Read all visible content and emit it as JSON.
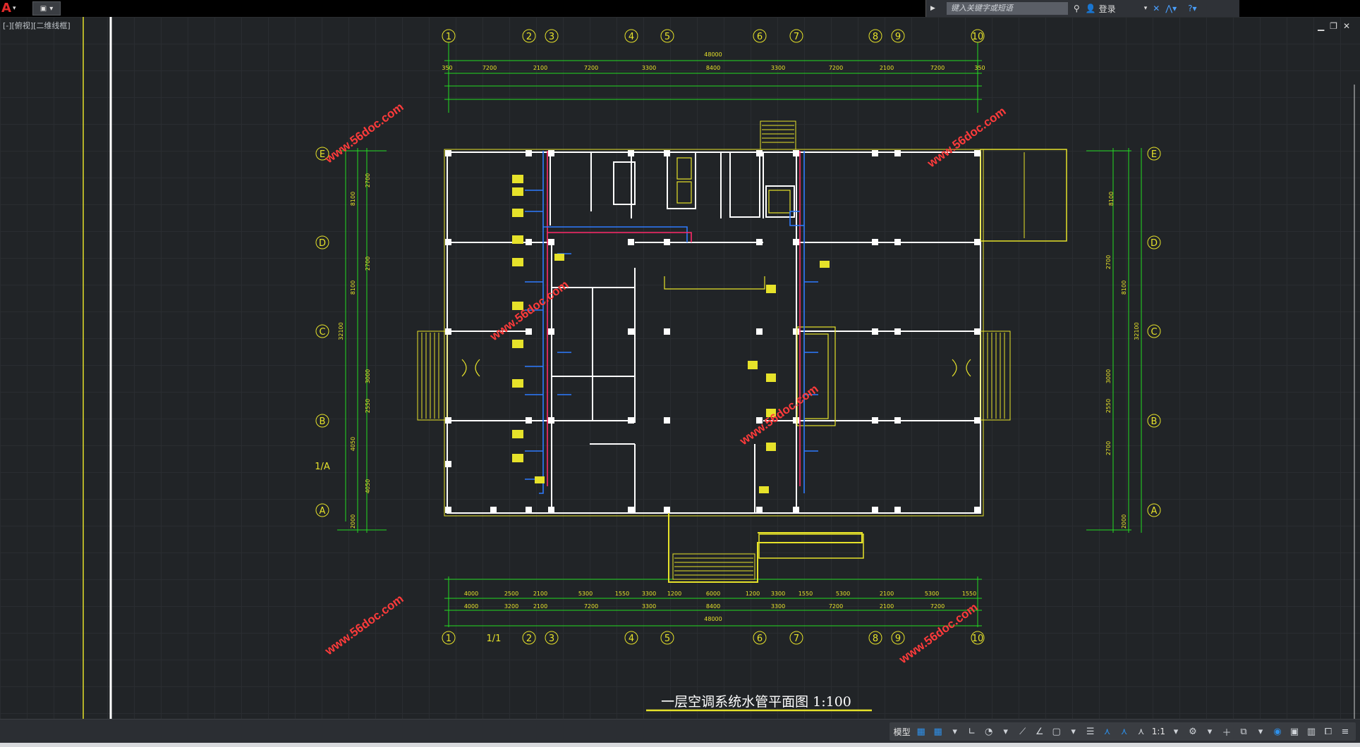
{
  "toolbar": {
    "search_placeholder": "键入关键字或短语",
    "login_label": "登录"
  },
  "viewport": {
    "label": "[-][俯视][二维线框]"
  },
  "drawing": {
    "title": "一层空调系统水管平面图 1:100",
    "watermark": "www.56doc.com",
    "axis_labels_top": [
      "1",
      "2",
      "3",
      "4",
      "5",
      "6",
      "7",
      "8",
      "9",
      "10"
    ],
    "axis_labels_bottom": [
      "1",
      "1/1",
      "2",
      "3",
      "4",
      "5",
      "6",
      "7",
      "8",
      "9",
      "10"
    ],
    "row_labels": [
      "E",
      "D",
      "C",
      "B",
      "1/A",
      "A"
    ],
    "dims_top_row1": [
      "350",
      "7200",
      "2100",
      "7200",
      "3300",
      "8400",
      "3300",
      "7200",
      "2100",
      "7200",
      "350"
    ],
    "dims_top_total": "48000",
    "dims_bottom_row1": [
      "4000",
      "2500",
      "2100",
      "5300",
      "1550",
      "3300",
      "1200",
      "6000",
      "1200",
      "3300",
      "1550",
      "5300",
      "2100",
      "5300",
      "1550"
    ],
    "dims_bottom_row2": [
      "4000",
      "3200",
      "2100",
      "7200",
      "3300",
      "8400",
      "3300",
      "7200",
      "2100",
      "7200"
    ],
    "dims_bottom_total": "48000",
    "dims_left": [
      "8100",
      "2700",
      "2700",
      "8100",
      "3000",
      "2550",
      "4050",
      "4050",
      "2000"
    ],
    "dims_right": [
      "8100",
      "2700",
      "3000",
      "8100",
      "2550",
      "2700",
      "2000"
    ],
    "total_left": "32100",
    "total_right": "32100"
  },
  "statusbar": {
    "model_label": "模型",
    "scale_label": "1:1"
  },
  "colors": {
    "background": "#212427",
    "dimension": "#22dd22",
    "walls": "#ffffff",
    "outline": "#e6e22a",
    "supply_pipe": "#2e7bff",
    "return_pipe": "#ff2a6a",
    "watermark": "#ff3b3b"
  }
}
